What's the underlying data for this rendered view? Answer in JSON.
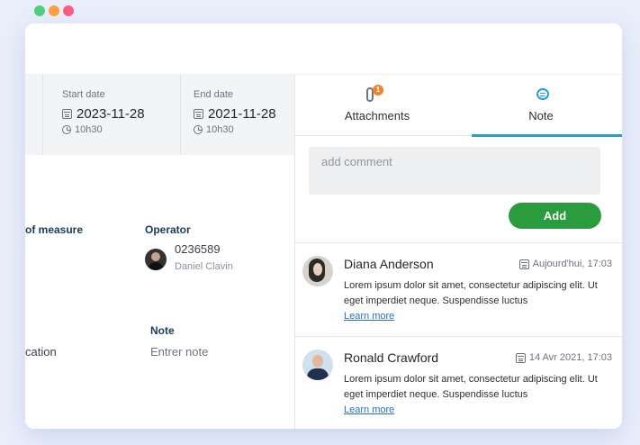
{
  "left": {
    "start_date": {
      "label": "Start date",
      "date": "2023-11-28",
      "time": "10h30"
    },
    "end_date": {
      "label": "End date",
      "date": "2021-11-28",
      "time": "10h30"
    },
    "unit_label": "of measure",
    "operator": {
      "label": "Operator",
      "id": "0236589",
      "name": "Daniel Clavin"
    },
    "location_value": "cation",
    "note": {
      "label": "Note",
      "placeholder": "Entrer note"
    }
  },
  "right": {
    "tabs": [
      {
        "label": "Attachments",
        "badge": "1"
      },
      {
        "label": "Note"
      }
    ],
    "comment_placeholder": "add comment",
    "add_label": "Add",
    "comments": [
      {
        "author": "Diana Anderson",
        "date": "Aujourd'hui, 17:03",
        "body": "Lorem ipsum dolor sit amet, consectetur adipiscing elit. Ut eget imperdiet neque. Suspendisse luctus",
        "link": "Learn more"
      },
      {
        "author": "Ronald Crawford",
        "date": "14 Avr 2021, 17:03",
        "body": "Lorem ipsum dolor sit amet, consectetur adipiscing elit. Ut eget imperdiet neque. Suspendisse luctus",
        "link": "Learn more"
      }
    ]
  },
  "colors": {
    "accent": "#2a9bd8",
    "add_button": "#2b9c3e",
    "badge": "#f0812d"
  }
}
